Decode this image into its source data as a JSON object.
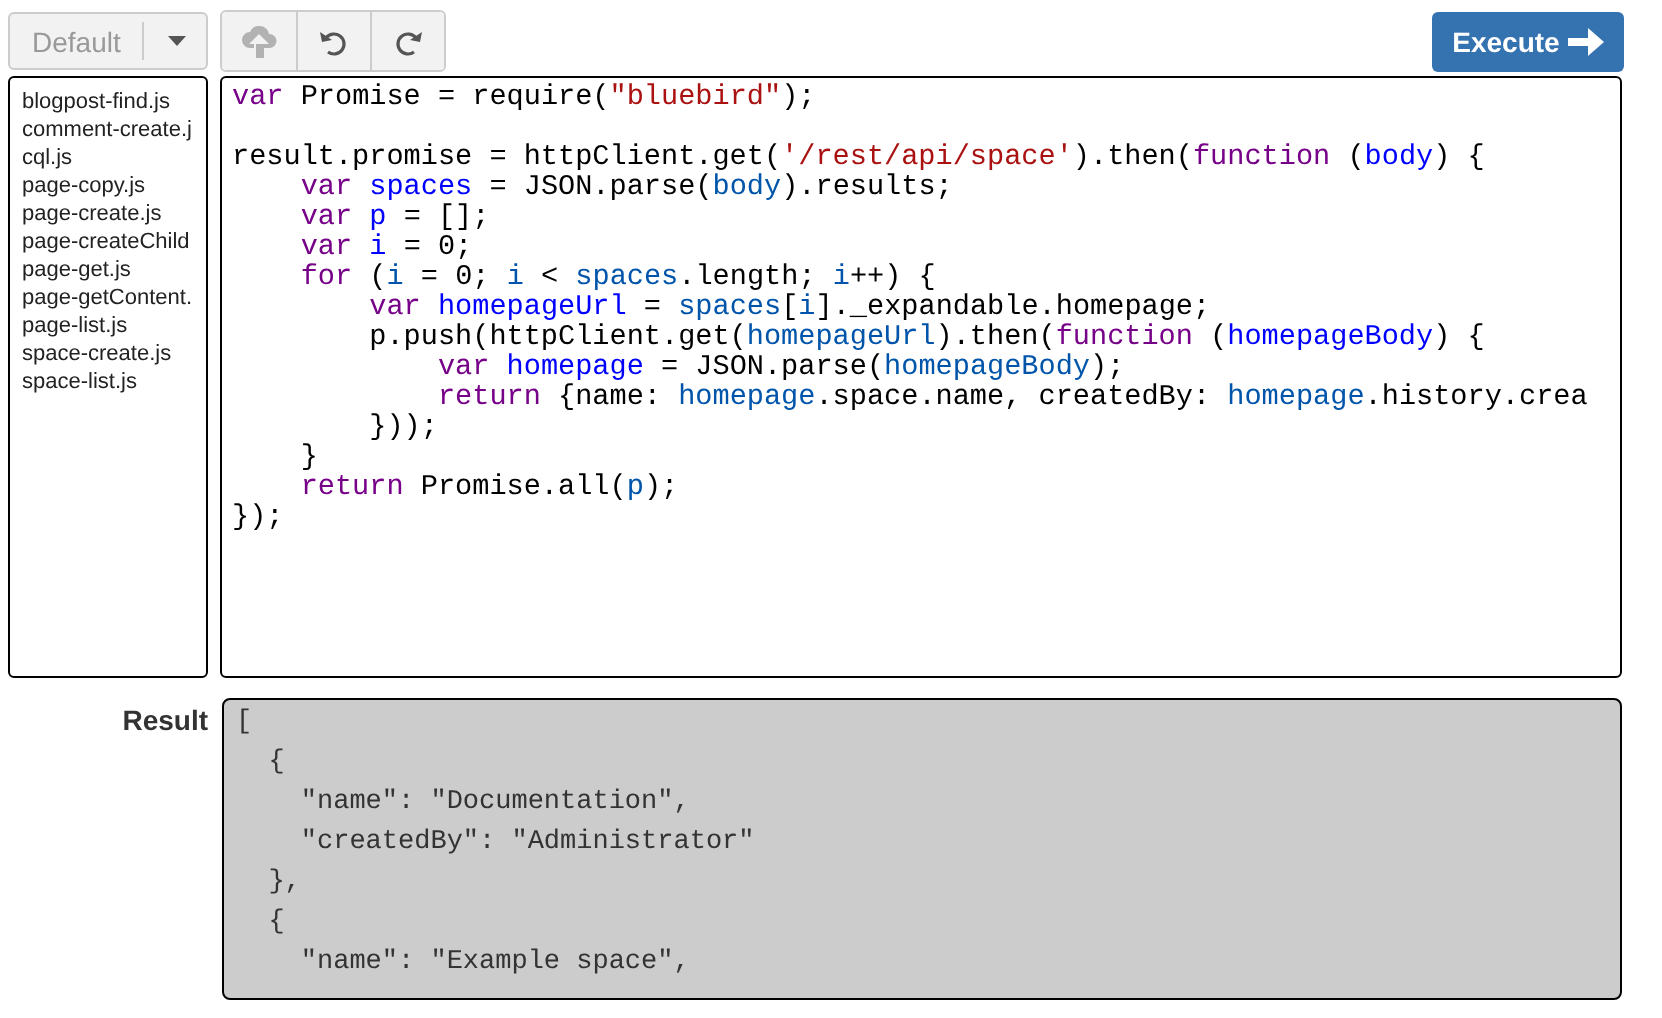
{
  "toolbar": {
    "profile_dropdown": {
      "label": "Default",
      "disabled": true
    },
    "history_buttons": [
      {
        "kind": "upload",
        "disabled": true
      },
      {
        "kind": "undo",
        "disabled": false
      },
      {
        "kind": "redo",
        "disabled": false
      }
    ],
    "execute_button": {
      "label": "Execute"
    }
  },
  "files": [
    "blogpost-find.js",
    "comment-create.j",
    "cql.js",
    "page-copy.js",
    "page-create.js",
    "page-createChild",
    "page-get.js",
    "page-getContent.",
    "page-list.js",
    "space-create.js",
    "space-list.js"
  ],
  "editor": {
    "blocks": [
      {
        "lines": [
          {
            "tokens": [
              {
                "kind": "keyword",
                "text": "var"
              },
              {
                "kind": "plain",
                "text": " Promise = require("
              },
              {
                "kind": "string",
                "text": "\"bluebird\""
              },
              {
                "kind": "plain",
                "text": ");"
              }
            ]
          }
        ]
      },
      {
        "lines": [
          {
            "tokens": [
              {
                "kind": "plain",
                "text": "result.promise = httpClient.get("
              },
              {
                "kind": "string",
                "text": "'/rest/api/space'"
              },
              {
                "kind": "plain",
                "text": ").then("
              },
              {
                "kind": "keyword",
                "text": "function"
              },
              {
                "kind": "plain",
                "text": " ("
              },
              {
                "kind": "def",
                "text": "body"
              },
              {
                "kind": "plain",
                "text": ") {"
              }
            ]
          },
          {
            "tokens": [
              {
                "kind": "keyword",
                "text": "    var "
              },
              {
                "kind": "def",
                "text": "spaces"
              },
              {
                "kind": "plain",
                "text": " = JSON.parse("
              },
              {
                "kind": "variable",
                "text": "body"
              },
              {
                "kind": "plain",
                "text": ").results;"
              }
            ]
          },
          {
            "tokens": [
              {
                "kind": "keyword",
                "text": "    var "
              },
              {
                "kind": "def",
                "text": "p"
              },
              {
                "kind": "plain",
                "text": " = [];"
              }
            ]
          },
          {
            "tokens": [
              {
                "kind": "keyword",
                "text": "    var "
              },
              {
                "kind": "def",
                "text": "i"
              },
              {
                "kind": "plain",
                "text": " = 0;"
              }
            ]
          },
          {
            "tokens": [
              {
                "kind": "keyword",
                "text": "    for"
              },
              {
                "kind": "plain",
                "text": " ("
              },
              {
                "kind": "variable",
                "text": "i"
              },
              {
                "kind": "plain",
                "text": " = 0; "
              },
              {
                "kind": "variable",
                "text": "i"
              },
              {
                "kind": "plain",
                "text": " < "
              },
              {
                "kind": "variable",
                "text": "spaces"
              },
              {
                "kind": "plain",
                "text": ".length; "
              },
              {
                "kind": "variable",
                "text": "i"
              },
              {
                "kind": "plain",
                "text": "++) {"
              }
            ]
          },
          {
            "tokens": [
              {
                "kind": "keyword",
                "text": "        var "
              },
              {
                "kind": "def",
                "text": "homepageUrl"
              },
              {
                "kind": "plain",
                "text": " = "
              },
              {
                "kind": "variable",
                "text": "spaces"
              },
              {
                "kind": "plain",
                "text": "["
              },
              {
                "kind": "variable",
                "text": "i"
              },
              {
                "kind": "plain",
                "text": "]._expandable.homepage;"
              }
            ]
          },
          {
            "tokens": [
              {
                "kind": "plain",
                "text": "        p.push(httpClient.get("
              },
              {
                "kind": "variable",
                "text": "homepageUrl"
              },
              {
                "kind": "plain",
                "text": ").then("
              },
              {
                "kind": "keyword",
                "text": "function"
              },
              {
                "kind": "plain",
                "text": " ("
              },
              {
                "kind": "def",
                "text": "homepageBody"
              },
              {
                "kind": "plain",
                "text": ") {"
              }
            ]
          },
          {
            "tokens": [
              {
                "kind": "keyword",
                "text": "            var "
              },
              {
                "kind": "def",
                "text": "homepage"
              },
              {
                "kind": "plain",
                "text": " = JSON.parse("
              },
              {
                "kind": "variable",
                "text": "homepageBody"
              },
              {
                "kind": "plain",
                "text": ");"
              }
            ]
          },
          {
            "tokens": [
              {
                "kind": "keyword",
                "text": "            return"
              },
              {
                "kind": "plain",
                "text": " {name: "
              },
              {
                "kind": "variable",
                "text": "homepage"
              },
              {
                "kind": "plain",
                "text": ".space.name, createdBy: "
              },
              {
                "kind": "variable",
                "text": "homepage"
              },
              {
                "kind": "plain",
                "text": ".history.crea"
              }
            ]
          },
          {
            "tokens": [
              {
                "kind": "plain",
                "text": "        }));"
              }
            ]
          },
          {
            "tokens": [
              {
                "kind": "plain",
                "text": "    }"
              }
            ]
          },
          {
            "tokens": [
              {
                "kind": "keyword",
                "text": "    return"
              },
              {
                "kind": "plain",
                "text": " Promise.all("
              },
              {
                "kind": "variable",
                "text": "p"
              },
              {
                "kind": "plain",
                "text": ");"
              }
            ]
          },
          {
            "tokens": [
              {
                "kind": "plain",
                "text": "});"
              }
            ]
          }
        ]
      }
    ]
  },
  "result": {
    "label": "Result",
    "lines": [
      "[",
      "  {",
      "    \"name\": \"Documentation\",",
      "    \"createdBy\": \"Administrator\"",
      "  },",
      "  {",
      "    \"name\": \"Example space\","
    ]
  }
}
